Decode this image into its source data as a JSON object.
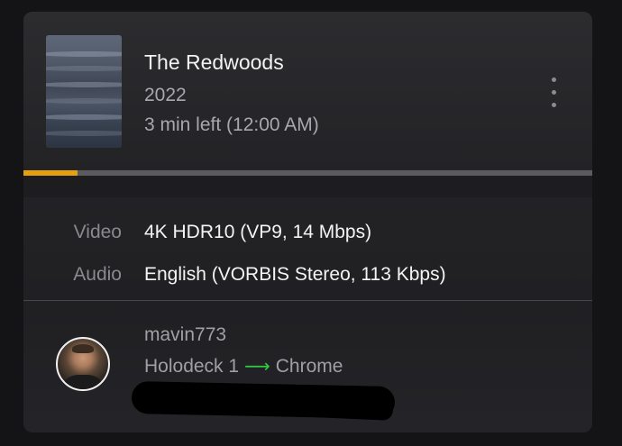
{
  "media": {
    "title": "The Redwoods",
    "year": "2022",
    "time_left": "3 min left (12:00 AM)",
    "progress_fraction": 0.095
  },
  "details": {
    "video_label": "Video",
    "video_value": "4K HDR10 (VP9, 14 Mbps)",
    "audio_label": "Audio",
    "audio_value": "English (VORBIS Stereo, 113 Kbps)"
  },
  "session": {
    "username": "mavin773",
    "player": "Holodeck 1",
    "arrow_icon": "right-arrow-icon",
    "client": "Chrome",
    "redacted": true
  },
  "colors": {
    "progress": "#e5a00d",
    "arrow": "#2ecc40"
  },
  "icons": {
    "menu": "kebab-menu-icon"
  }
}
